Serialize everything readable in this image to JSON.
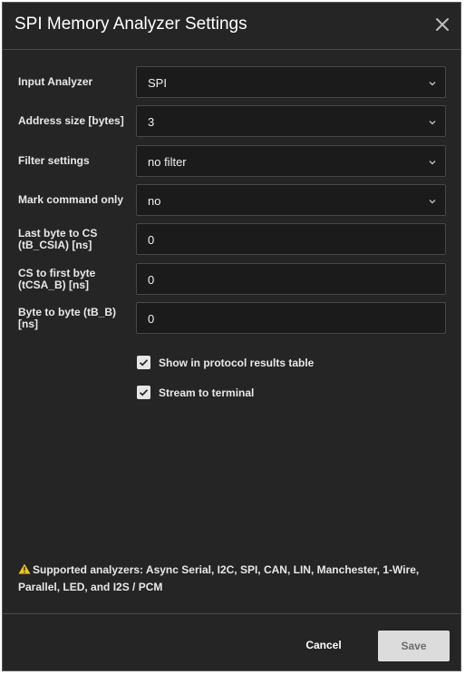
{
  "dialog": {
    "title": "SPI Memory Analyzer Settings",
    "close_icon": "close-icon"
  },
  "settings": [
    {
      "label": "Input Analyzer",
      "value": "SPI",
      "kind": "select"
    },
    {
      "label": "Address size [bytes]",
      "value": "3",
      "kind": "select"
    },
    {
      "label": "Filter settings",
      "value": "no filter",
      "kind": "select"
    },
    {
      "label": "Mark command only",
      "value": "no",
      "kind": "select"
    },
    {
      "label": "Last byte to CS (tB_CSIA) [ns]",
      "value": "0",
      "kind": "input"
    },
    {
      "label": "CS to first byte (tCSA_B) [ns]",
      "value": "0",
      "kind": "input"
    },
    {
      "label": "Byte to byte (tB_B) [ns]",
      "value": "0",
      "kind": "input"
    }
  ],
  "options": [
    {
      "label": "Show in protocol results table",
      "checked": true
    },
    {
      "label": "Stream to terminal",
      "checked": true
    }
  ],
  "note": {
    "icon": "warning-icon",
    "text": "Supported analyzers: Async Serial, I2C, SPI, CAN, LIN, Manchester, 1-Wire, Parallel, LED, and I2S / PCM"
  },
  "footer": {
    "cancel_label": "Cancel",
    "save_label": "Save"
  },
  "colors": {
    "background": "#252526",
    "field_background": "#1b1b1c",
    "field_border": "#474747",
    "warning": "#f0c419",
    "save_button": "#dcdcdc"
  }
}
